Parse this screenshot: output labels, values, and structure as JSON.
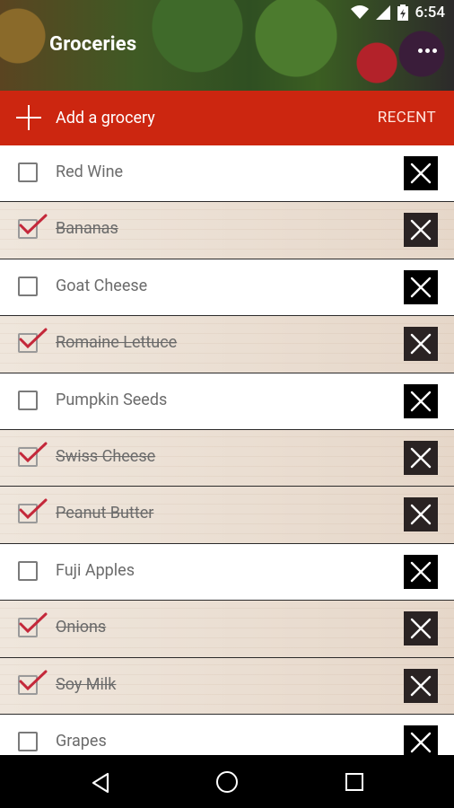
{
  "status": {
    "time": "6:54"
  },
  "header": {
    "title": "Groceries"
  },
  "addbar": {
    "label": "Add a grocery",
    "recent_label": "RECENT"
  },
  "items": [
    {
      "name": "Red Wine",
      "checked": false
    },
    {
      "name": "Bananas",
      "checked": true
    },
    {
      "name": "Goat Cheese",
      "checked": false
    },
    {
      "name": "Romaine Lettuce",
      "checked": true
    },
    {
      "name": "Pumpkin Seeds",
      "checked": false
    },
    {
      "name": "Swiss Cheese",
      "checked": true
    },
    {
      "name": "Peanut Butter",
      "checked": true
    },
    {
      "name": "Fuji Apples",
      "checked": false
    },
    {
      "name": "Onions",
      "checked": true
    },
    {
      "name": "Soy Milk",
      "checked": true
    },
    {
      "name": "Grapes",
      "checked": false
    }
  ],
  "colors": {
    "accent": "#cc2610",
    "check_tick": "#c4283a"
  },
  "icons": [
    "plus-icon",
    "overflow-menu-icon",
    "checkbox-icon",
    "close-icon",
    "back-icon",
    "home-icon",
    "recents-icon",
    "wifi-icon",
    "signal-icon",
    "battery-icon"
  ]
}
